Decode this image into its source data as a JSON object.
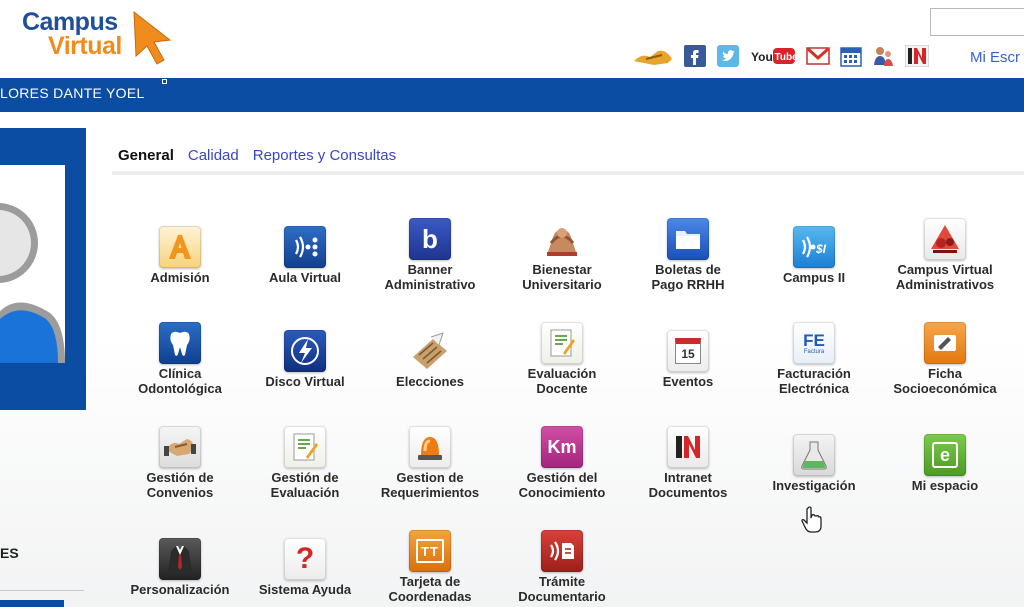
{
  "header": {
    "logo_line1": "Campus",
    "logo_line2": "Virtual",
    "mi_escritorio": "Mi Escr",
    "social_icons": [
      "handshake-icon",
      "facebook-icon",
      "twitter-icon",
      "youtube-icon",
      "gmail-icon",
      "calendar-icon",
      "people-icon",
      "intranet-icon"
    ],
    "youtube_label": "YouTube",
    "intranet_label": "IN"
  },
  "user": {
    "name": "LORES DANTE YOEL"
  },
  "sidebar": {
    "label": "ES"
  },
  "tabs": [
    {
      "label": "General",
      "active": true
    },
    {
      "label": "Calidad",
      "active": false
    },
    {
      "label": "Reportes y Consultas",
      "active": false
    }
  ],
  "apps": [
    {
      "l1": "Admisión",
      "l2": "",
      "icon": "admision-icon"
    },
    {
      "l1": "Aula Virtual",
      "l2": "",
      "icon": "aula-virtual-icon"
    },
    {
      "l1": "Banner",
      "l2": "Administrativo",
      "icon": "banner-icon",
      "glyph": "b"
    },
    {
      "l1": "Bienestar",
      "l2": "Universitario",
      "icon": "bienestar-icon"
    },
    {
      "l1": "Boletas de",
      "l2": "Pago RRHH",
      "icon": "boletas-folder-icon"
    },
    {
      "l1": "Campus II",
      "l2": "",
      "icon": "campus-ii-icon"
    },
    {
      "l1": "Campus Virtual",
      "l2": "Administrativos",
      "icon": "campus-virtual-admin-icon"
    },
    {
      "l1": "Clínica",
      "l2": "Odontológica",
      "icon": "tooth-icon"
    },
    {
      "l1": "Disco Virtual",
      "l2": "",
      "icon": "disco-virtual-icon"
    },
    {
      "l1": "Elecciones",
      "l2": "",
      "icon": "ballot-icon"
    },
    {
      "l1": "Evaluación",
      "l2": "Docente",
      "icon": "evaluacion-docente-icon"
    },
    {
      "l1": "Eventos",
      "l2": "",
      "icon": "calendar-15-icon",
      "glyph": "15"
    },
    {
      "l1": "Facturación",
      "l2": "Electrónica",
      "icon": "factura-fe-icon",
      "glyph": "FE",
      "glyph2": "Factura"
    },
    {
      "l1": "Ficha",
      "l2": "Socioeconómica",
      "icon": "ficha-icon"
    },
    {
      "l1": "Gestión de",
      "l2": "Convenios",
      "icon": "convenios-handshake-icon"
    },
    {
      "l1": "Gestión de",
      "l2": "Evaluación",
      "icon": "gestion-evaluacion-icon"
    },
    {
      "l1": "Gestion de",
      "l2": "Requerimientos",
      "icon": "siren-icon"
    },
    {
      "l1": "Gestión del",
      "l2": "Conocimiento",
      "icon": "km-icon",
      "glyph": "Km"
    },
    {
      "l1": "Intranet",
      "l2": "Documentos",
      "icon": "intranet-documentos-icon",
      "glyph": "IN"
    },
    {
      "l1": "Investigación",
      "l2": "",
      "icon": "flask-icon"
    },
    {
      "l1": "Mi espacio",
      "l2": "",
      "icon": "mi-espacio-icon",
      "glyph": "e"
    },
    {
      "l1": "Personalización",
      "l2": "",
      "icon": "suit-icon"
    },
    {
      "l1": "Sistema Ayuda",
      "l2": "",
      "icon": "help-question-icon",
      "glyph": "?"
    },
    {
      "l1": "Tarjeta de",
      "l2": "Coordenadas",
      "icon": "tarjeta-icon",
      "glyph": "TT"
    },
    {
      "l1": "Trámite",
      "l2": "Documentario",
      "icon": "tramite-icon"
    }
  ]
}
